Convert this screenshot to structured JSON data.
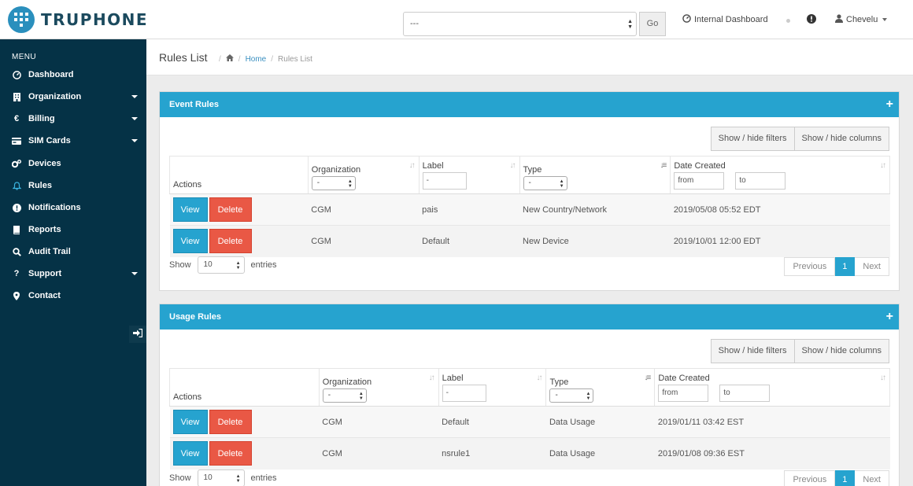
{
  "brand": {
    "name": "TRUPHONE"
  },
  "topbar": {
    "org_select_value": "---",
    "go_label": "Go",
    "internal_dashboard": "Internal Dashboard",
    "user_name": "Chevelu"
  },
  "sidebar": {
    "menu_title": "MENU",
    "items": [
      {
        "label": "Dashboard",
        "icon": "dashboard-icon"
      },
      {
        "label": "Organization",
        "icon": "building-icon"
      },
      {
        "label": "Billing",
        "icon": "euro-icon"
      },
      {
        "label": "SIM Cards",
        "icon": "card-icon"
      },
      {
        "label": "Devices",
        "icon": "cogs-icon"
      },
      {
        "label": "Rules",
        "icon": "bell-icon"
      },
      {
        "label": "Notifications",
        "icon": "exclamation-icon"
      },
      {
        "label": "Reports",
        "icon": "book-icon"
      },
      {
        "label": "Audit Trail",
        "icon": "search-icon"
      },
      {
        "label": "Support",
        "icon": "question-icon"
      },
      {
        "label": "Contact",
        "icon": "map-marker-icon"
      }
    ]
  },
  "header": {
    "title": "Rules List",
    "breadcrumb_home": "Home",
    "breadcrumb_current": "Rules List"
  },
  "event_rules": {
    "title": "Event Rules",
    "show_filters": "Show / hide filters",
    "show_columns": "Show / hide columns",
    "columns": {
      "actions": "Actions",
      "organization": "Organization",
      "label": "Label",
      "type": "Type",
      "date_created": "Date Created"
    },
    "filters": {
      "organization": "-",
      "label": "-",
      "type": "-",
      "from": "from",
      "to": "to"
    },
    "rows": [
      {
        "view": "View",
        "delete": "Delete",
        "organization": "CGM",
        "label": "pais",
        "type": "New Country/Network",
        "date": "2019/05/08 05:52 EDT"
      },
      {
        "view": "View",
        "delete": "Delete",
        "organization": "CGM",
        "label": "Default",
        "type": "New Device",
        "date": "2019/10/01 12:00 EDT"
      }
    ],
    "show": "Show",
    "entries_value": "10",
    "entries": "entries",
    "prev": "Previous",
    "page": "1",
    "next": "Next"
  },
  "usage_rules": {
    "title": "Usage Rules",
    "show_filters": "Show / hide filters",
    "show_columns": "Show / hide columns",
    "columns": {
      "actions": "Actions",
      "organization": "Organization",
      "label": "Label",
      "type": "Type",
      "date_created": "Date Created"
    },
    "filters": {
      "organization": "-",
      "label": "-",
      "type": "-",
      "from": "from",
      "to": "to"
    },
    "rows": [
      {
        "view": "View",
        "delete": "Delete",
        "organization": "CGM",
        "label": "Default",
        "type": "Data Usage",
        "date": "2019/01/11 03:42 EST"
      },
      {
        "view": "View",
        "delete": "Delete",
        "organization": "CGM",
        "label": "nsrule1",
        "type": "Data Usage",
        "date": "2019/01/08 09:36 EST"
      }
    ],
    "show": "Show",
    "entries_value": "10",
    "entries": "entries",
    "prev": "Previous",
    "page": "1",
    "next": "Next"
  },
  "colors": {
    "accent": "#26a3cf",
    "danger": "#e95845",
    "sidebar": "#053246",
    "brand_dark": "#1b4a5e"
  }
}
